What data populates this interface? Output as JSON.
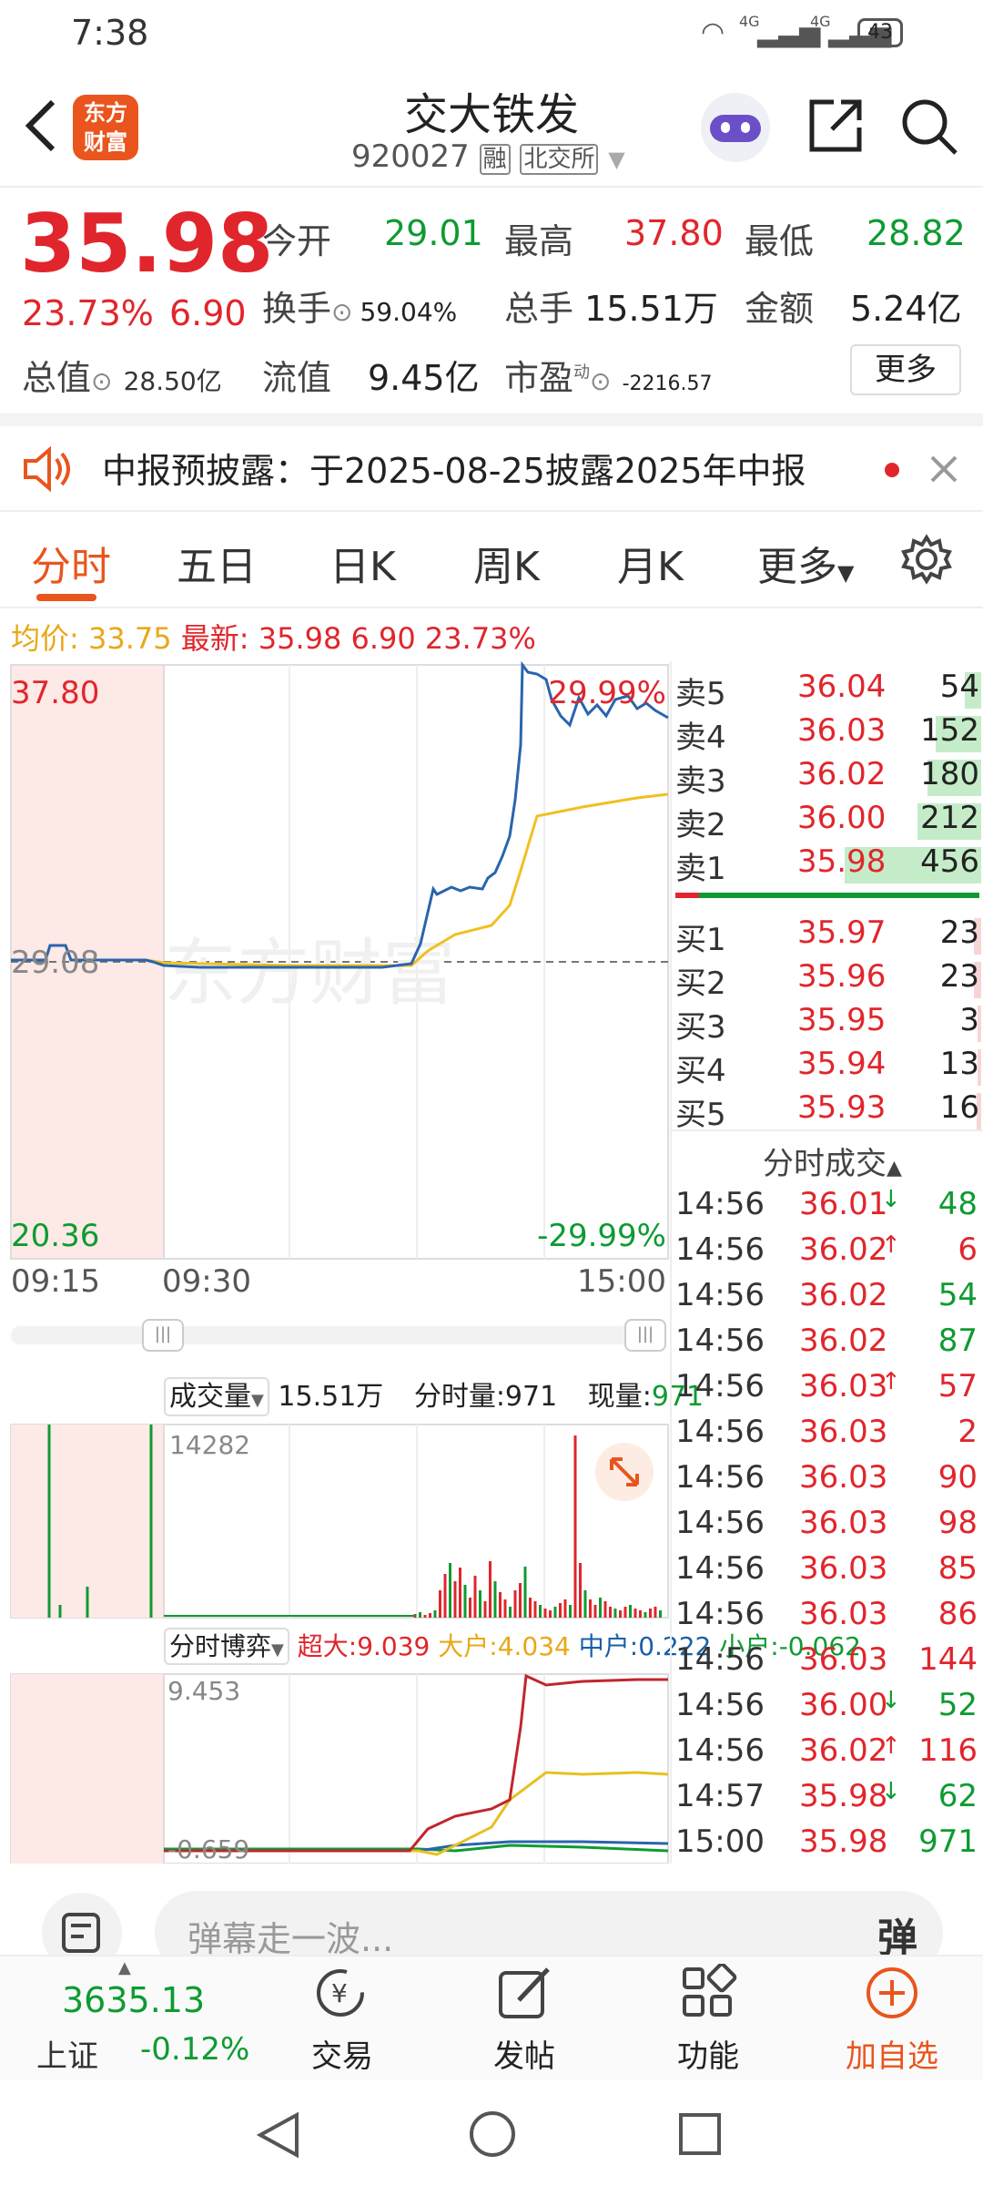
{
  "status": {
    "time": "7:38",
    "battery": "43",
    "net1": "4G",
    "net2": "4G"
  },
  "header": {
    "name": "交大铁发",
    "code": "920027",
    "tag1": "融",
    "tag2": "北交所",
    "logo_line1": "东方",
    "logo_line2": "财富"
  },
  "quote": {
    "price": "35.98",
    "pct": "23.73%",
    "chg": "6.90",
    "open_label": "今开",
    "open": "29.01",
    "high_label": "最高",
    "high": "37.80",
    "low_label": "最低",
    "low": "28.82",
    "turnover_label": "换手",
    "turnover": "59.04%",
    "vol_label": "总手",
    "vol": "15.51万",
    "amt_label": "金额",
    "amt": "5.24亿",
    "mcap_label": "总值",
    "mcap": "28.50亿",
    "float_label": "流值",
    "float": "9.45亿",
    "pe_label": "市盈",
    "pe_sup": "动",
    "pe": "-2216.57",
    "more": "更多"
  },
  "notice": {
    "text": "中报预披露：于2025-08-25披露2025年中报"
  },
  "tabs": [
    "分时",
    "五日",
    "日K",
    "周K",
    "月K",
    "更多"
  ],
  "legend": {
    "avg_label": "均价:",
    "avg": "33.75",
    "last_label": "最新:",
    "last": "35.98",
    "chg": "6.90",
    "pct": "23.73%"
  },
  "chart": {
    "y_top": "37.80",
    "y_mid": "29.08",
    "y_bot": "20.36",
    "pct_top": "29.99%",
    "pct_bot": "-29.99%",
    "t1": "09:15",
    "t2": "09:30",
    "t3": "15:00",
    "watermark": "东方财富"
  },
  "volume": {
    "title": "成交量",
    "total": "15.51万",
    "fen_label": "分时量:971",
    "xian_label": "现量:",
    "xian": "971",
    "max": "14282"
  },
  "game": {
    "title": "分时博弈",
    "super": "超大:9.039",
    "big": "大户:4.034",
    "mid": "中户:0.222",
    "small": "小户:-0.062",
    "max": "9.453",
    "min": "-0.659"
  },
  "orderbook": {
    "sell": [
      {
        "n": "卖5",
        "p": "36.04",
        "v": "54"
      },
      {
        "n": "卖4",
        "p": "36.03",
        "v": "152"
      },
      {
        "n": "卖3",
        "p": "36.02",
        "v": "180"
      },
      {
        "n": "卖2",
        "p": "36.00",
        "v": "212"
      },
      {
        "n": "卖1",
        "p": "35.98",
        "v": "456"
      }
    ],
    "buy": [
      {
        "n": "买1",
        "p": "35.97",
        "v": "23"
      },
      {
        "n": "买2",
        "p": "35.96",
        "v": "23"
      },
      {
        "n": "买3",
        "p": "35.95",
        "v": "3"
      },
      {
        "n": "买4",
        "p": "35.94",
        "v": "13"
      },
      {
        "n": "买5",
        "p": "35.93",
        "v": "16"
      }
    ]
  },
  "ticks_title": "分时成交",
  "ticks": [
    {
      "t": "14:56",
      "p": "36.01",
      "a": "↓",
      "v": "48",
      "c": "green"
    },
    {
      "t": "14:56",
      "p": "36.02",
      "a": "↑",
      "v": "6",
      "c": "red"
    },
    {
      "t": "14:56",
      "p": "36.02",
      "a": "",
      "v": "54",
      "c": "green"
    },
    {
      "t": "14:56",
      "p": "36.02",
      "a": "",
      "v": "87",
      "c": "green"
    },
    {
      "t": "14:56",
      "p": "36.03",
      "a": "↑",
      "v": "57",
      "c": "red"
    },
    {
      "t": "14:56",
      "p": "36.03",
      "a": "",
      "v": "2",
      "c": "red"
    },
    {
      "t": "14:56",
      "p": "36.03",
      "a": "",
      "v": "90",
      "c": "red"
    },
    {
      "t": "14:56",
      "p": "36.03",
      "a": "",
      "v": "98",
      "c": "red"
    },
    {
      "t": "14:56",
      "p": "36.03",
      "a": "",
      "v": "85",
      "c": "red"
    },
    {
      "t": "14:56",
      "p": "36.03",
      "a": "",
      "v": "86",
      "c": "red"
    },
    {
      "t": "14:56",
      "p": "36.03",
      "a": "",
      "v": "144",
      "c": "red"
    },
    {
      "t": "14:56",
      "p": "36.00",
      "a": "↓",
      "v": "52",
      "c": "green"
    },
    {
      "t": "14:56",
      "p": "36.02",
      "a": "↑",
      "v": "116",
      "c": "red"
    },
    {
      "t": "14:57",
      "p": "35.98",
      "a": "↓",
      "v": "62",
      "c": "green"
    },
    {
      "t": "15:00",
      "p": "35.98",
      "a": "",
      "v": "971",
      "c": "green"
    }
  ],
  "comment": {
    "placeholder": "弹幕走一波...",
    "danmu": "弹"
  },
  "bottom": {
    "index_val": "3635.13",
    "index_name": "上证",
    "index_pct": "-0.12%",
    "trade": "交易",
    "post": "发帖",
    "func": "功能",
    "add": "加自选"
  }
}
